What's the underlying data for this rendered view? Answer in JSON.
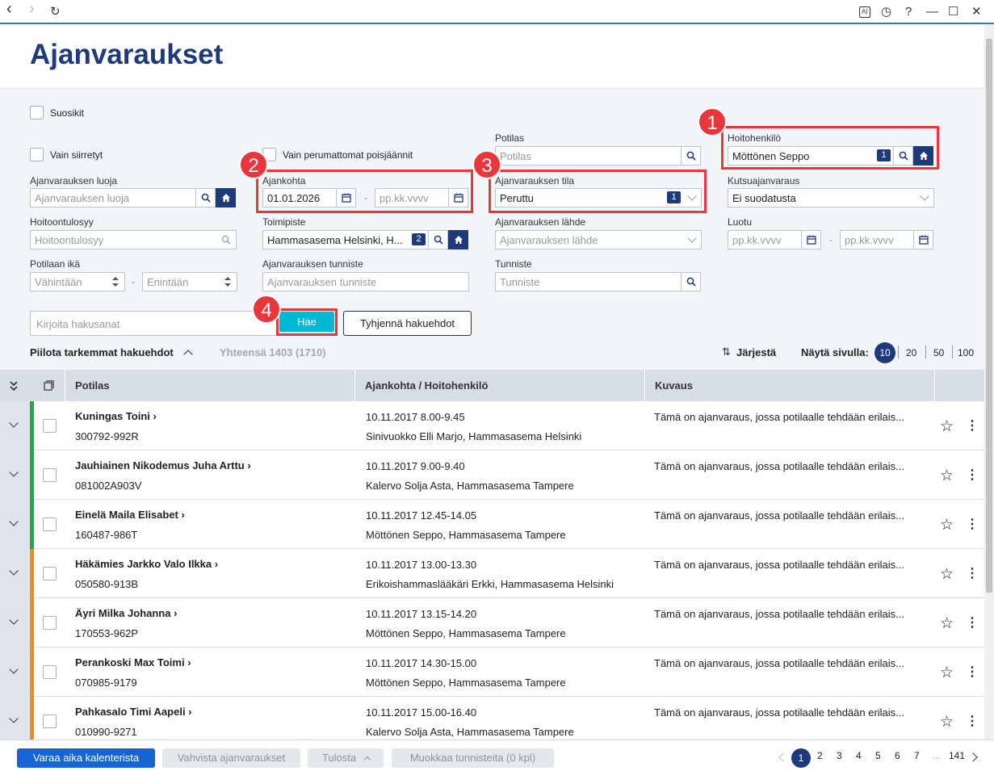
{
  "titlebar": {
    "back": "‹",
    "forward": "›",
    "reload": "↻",
    "ai": "AI",
    "history": "◷",
    "help": "?",
    "minimize": "—",
    "maximize": "☐",
    "close": "✕"
  },
  "page": {
    "title": "Ajanvaraukset"
  },
  "filters": {
    "favorites": "Suosikit",
    "only_moved": "Vain siirretyt",
    "only_uncancelled": "Vain perumattomat poisjäännit",
    "creator": {
      "label": "Ajanvarauksen luoja",
      "placeholder": "Ajanvarauksen luoja"
    },
    "reason": {
      "label": "Hoitoontulosyy",
      "placeholder": "Hoitoontulosyy"
    },
    "age": {
      "label": "Potilaan ikä",
      "min": "Vähintään",
      "max": "Enintään",
      "dash": "-"
    },
    "date": {
      "label": "Ajankohta",
      "from": "01.01.2026",
      "to": "pp.kk.vvvv",
      "dash": "-"
    },
    "unit": {
      "label": "Toimipiste",
      "value": "Hammasasema Helsinki, H...",
      "count": "2"
    },
    "booking_id": {
      "label": "Ajanvarauksen tunniste",
      "placeholder": "Ajanvarauksen tunniste"
    },
    "patient": {
      "label": "Potilas",
      "placeholder": "Potilas"
    },
    "status": {
      "label": "Ajanvarauksen tila",
      "value": "Peruttu",
      "count": "1"
    },
    "source": {
      "label": "Ajanvarauksen lähde",
      "placeholder": "Ajanvarauksen lähde"
    },
    "identifier": {
      "label": "Tunniste",
      "placeholder": "Tunniste"
    },
    "staff": {
      "label": "Hoitohenkilö",
      "value": "Möttönen Seppo",
      "count": "1"
    },
    "invite": {
      "label": "Kutsuajanvaraus",
      "value": "Ei suodatusta"
    },
    "created": {
      "label": "Luotu",
      "from": "pp.kk.vvvv",
      "to": "pp.kk.vvvv",
      "dash": "-"
    },
    "search": {
      "placeholder": "Kirjoita hakusanat",
      "button": "Hae",
      "clear": "Tyhjennä hakuehdot"
    },
    "hide_more": "Piilota tarkemmat hakuehdot",
    "total": "Yhteensä 1403 (1710)",
    "sort": "Järjestä",
    "per_page_label": "Näytä sivulla:",
    "per_page": [
      "10",
      "20",
      "50",
      "100"
    ]
  },
  "badges": [
    "1",
    "2",
    "3",
    "4"
  ],
  "table": {
    "headers": {
      "patient": "Potilas",
      "time": "Ajankohta / Hoitohenkilö",
      "desc": "Kuvaus"
    },
    "rows": [
      {
        "name": "Kuningas Toini",
        "id": "300792-992R",
        "time": "10.11.2017 8.00-9.45",
        "staff": "Sinivuokko Elli Marjo, Hammasasema Helsinki",
        "desc": "Tämä on ajanvaraus, jossa potilaalle tehdään erilais...",
        "color": "#1aab4b"
      },
      {
        "name": "Jauhiainen Nikodemus Juha Arttu",
        "id": "081002A903V",
        "time": "10.11.2017 9.00-9.40",
        "staff": "Kalervo Solja Asta, Hammasasema Tampere",
        "desc": "Tämä on ajanvaraus, jossa potilaalle tehdään erilais...",
        "color": "#1aab4b"
      },
      {
        "name": "Einelä Maila Elisabet",
        "id": "160487-986T",
        "time": "10.11.2017 12.45-14.05",
        "staff": "Möttönen Seppo, Hammasasema Tampere",
        "desc": "Tämä on ajanvaraus, jossa potilaalle tehdään erilais...",
        "color": "#1aab4b"
      },
      {
        "name": "Häkämies Jarkko Valo Ilkka",
        "id": "050580-913B",
        "time": "10.11.2017 13.00-13.30",
        "staff": "Erikoishammaslääkäri Erkki, Hammasasema Helsinki",
        "desc": "Tämä on ajanvaraus, jossa potilaalle tehdään erilais...",
        "color": "#f08a1c"
      },
      {
        "name": "Äyri Milka Johanna",
        "id": "170553-962P",
        "time": "10.11.2017 13.15-14.20",
        "staff": "Möttönen Seppo, Hammasasema Tampere",
        "desc": "Tämä on ajanvaraus, jossa potilaalle tehdään erilais...",
        "color": "#f08a1c"
      },
      {
        "name": "Perankoski Max Toimi",
        "id": "070985-9179",
        "time": "10.11.2017 14.30-15.00",
        "staff": "Möttönen Seppo, Hammasasema Tampere",
        "desc": "Tämä on ajanvaraus, jossa potilaalle tehdään erilais...",
        "color": "#f08a1c"
      },
      {
        "name": "Pahkasalo Timi Aapeli",
        "id": "010990-9271",
        "time": "10.11.2017 15.00-16.40",
        "staff": "Kalervo Solja Asta, Hammasasema Tampere",
        "desc": "Tämä on ajanvaraus, jossa potilaalle tehdään erilais...",
        "color": "#f08a1c"
      }
    ]
  },
  "footer": {
    "book": "Varaa aika kalenterista",
    "confirm": "Vahvista ajanvaraukset",
    "print": "Tulosta",
    "edit_ids": "Muokkaa tunnisteita (0 kpl)",
    "pages": [
      "1",
      "2",
      "3",
      "4",
      "5",
      "6",
      "7"
    ],
    "ellipsis": "...",
    "last": "141"
  },
  "colors": {
    "primary": "#1f3a7a",
    "accent": "#1565d8",
    "search": "#00b8d4",
    "highlight": "#e8363c"
  }
}
